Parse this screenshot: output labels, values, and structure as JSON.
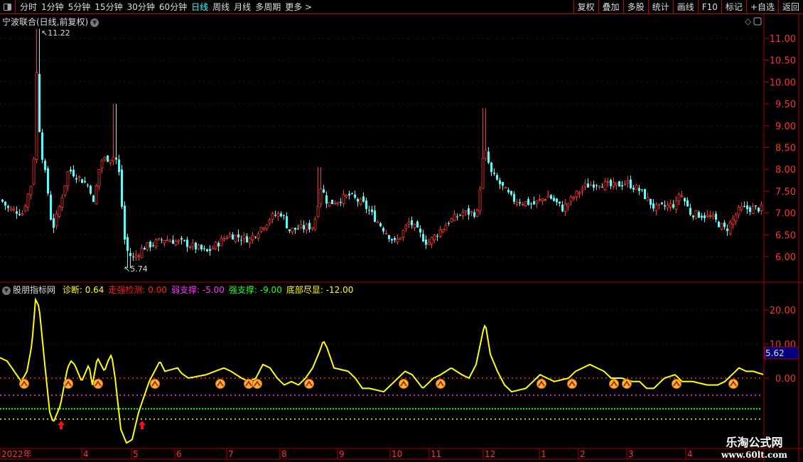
{
  "toolbar": {
    "periods": [
      "分时",
      "1分钟",
      "5分钟",
      "15分钟",
      "30分钟",
      "60分钟",
      "日线",
      "周线",
      "月线",
      "多周期",
      "更多 >"
    ],
    "active": "日线",
    "buttons": [
      "复权",
      "叠加",
      "多股",
      "统计",
      "画线",
      "F10",
      "标记",
      "+自选",
      "返回"
    ]
  },
  "main": {
    "title": "宁波联合(日线,前复权)",
    "high_label": "11.22",
    "low_label": "5.74",
    "y_ticks": [
      "11.00",
      "10.50",
      "10.00",
      "9.50",
      "9.00",
      "8.50",
      "8.00",
      "7.50",
      "7.00",
      "6.50",
      "6.00"
    ]
  },
  "indicator": {
    "name": "股朋指标网",
    "items": [
      {
        "label": "诊断: 0.64",
        "color": "#ffff00"
      },
      {
        "label": "走强检测: 0.00",
        "color": "#ff2020"
      },
      {
        "label": "弱支撑: -5.00",
        "color": "#ff30ff"
      },
      {
        "label": "强支撑: -9.00",
        "color": "#20ff20"
      },
      {
        "label": "底部尽显: -12.00",
        "color": "#ffff00"
      }
    ],
    "y_ticks": [
      "20.00",
      "10.00",
      "0.00"
    ],
    "current_value": "5.62"
  },
  "x_axis": {
    "labels": [
      "2022年",
      "4",
      "5",
      "6",
      "7",
      "8",
      "9",
      "10",
      "11",
      "12",
      "1",
      "2",
      "3",
      "4"
    ]
  },
  "watermark": {
    "line1": "乐淘公式网",
    "line2": "www.60lt.com"
  },
  "colors": {
    "up": "#ff3232",
    "down": "#54ffff",
    "line": "#ffff00",
    "grid": "#b00000"
  },
  "chart_data": {
    "type": "line",
    "xlim": [
      0,
      1075
    ],
    "price": {
      "ylim": [
        5.5,
        11.5
      ],
      "keypoints": [
        [
          0,
          7.3
        ],
        [
          10,
          7.1
        ],
        [
          30,
          7.0
        ],
        [
          45,
          7.8
        ],
        [
          50,
          10.2
        ],
        [
          55,
          8.6
        ],
        [
          65,
          7.6
        ],
        [
          72,
          6.6
        ],
        [
          80,
          7.0
        ],
        [
          95,
          8.0
        ],
        [
          110,
          7.8
        ],
        [
          125,
          7.6
        ],
        [
          130,
          7.2
        ],
        [
          140,
          8.2
        ],
        [
          160,
          8.3
        ],
        [
          165,
          8.1
        ],
        [
          175,
          6.2
        ],
        [
          185,
          5.95
        ],
        [
          200,
          6.2
        ],
        [
          230,
          6.4
        ],
        [
          260,
          6.3
        ],
        [
          290,
          6.1
        ],
        [
          320,
          6.5
        ],
        [
          350,
          6.4
        ],
        [
          380,
          6.9
        ],
        [
          395,
          7.0
        ],
        [
          405,
          6.6
        ],
        [
          440,
          6.7
        ],
        [
          450,
          7.6
        ],
        [
          460,
          7.2
        ],
        [
          490,
          7.4
        ],
        [
          510,
          7.2
        ],
        [
          530,
          6.8
        ],
        [
          555,
          6.3
        ],
        [
          575,
          6.8
        ],
        [
          600,
          6.3
        ],
        [
          630,
          6.8
        ],
        [
          650,
          7.0
        ],
        [
          670,
          7.0
        ],
        [
          680,
          8.5
        ],
        [
          690,
          7.9
        ],
        [
          700,
          7.7
        ],
        [
          720,
          7.3
        ],
        [
          750,
          7.2
        ],
        [
          770,
          7.4
        ],
        [
          790,
          7.1
        ],
        [
          820,
          7.6
        ],
        [
          840,
          7.7
        ],
        [
          860,
          7.6
        ],
        [
          880,
          7.7
        ],
        [
          900,
          7.5
        ],
        [
          920,
          7.1
        ],
        [
          950,
          7.2
        ],
        [
          955,
          7.5
        ],
        [
          970,
          7.0
        ],
        [
          1000,
          6.9
        ],
        [
          1020,
          6.6
        ],
        [
          1040,
          7.1
        ],
        [
          1075,
          7.1
        ]
      ]
    },
    "indicator": {
      "ylim": [
        -20,
        26
      ],
      "levels": [
        0,
        -5,
        -9,
        -12
      ],
      "keypoints": [
        [
          0,
          6
        ],
        [
          10,
          5
        ],
        [
          20,
          2
        ],
        [
          30,
          -1
        ],
        [
          38,
          2
        ],
        [
          45,
          10
        ],
        [
          50,
          23
        ],
        [
          55,
          21
        ],
        [
          65,
          0
        ],
        [
          70,
          -10
        ],
        [
          75,
          -13
        ],
        [
          85,
          -8
        ],
        [
          95,
          3
        ],
        [
          100,
          5
        ],
        [
          105,
          4
        ],
        [
          115,
          -1
        ],
        [
          125,
          4
        ],
        [
          130,
          -2
        ],
        [
          137,
          6
        ],
        [
          142,
          4
        ],
        [
          147,
          2
        ],
        [
          152,
          5
        ],
        [
          157,
          7
        ],
        [
          162,
          0
        ],
        [
          170,
          -15
        ],
        [
          178,
          -19
        ],
        [
          186,
          -18
        ],
        [
          195,
          -10
        ],
        [
          205,
          -4
        ],
        [
          210,
          -1
        ],
        [
          220,
          3
        ],
        [
          225,
          5
        ],
        [
          232,
          2
        ],
        [
          250,
          3
        ],
        [
          255,
          1.5
        ],
        [
          265,
          0
        ],
        [
          290,
          1
        ],
        [
          315,
          3
        ],
        [
          325,
          2
        ],
        [
          340,
          0
        ],
        [
          350,
          -1
        ],
        [
          360,
          0
        ],
        [
          370,
          4
        ],
        [
          380,
          3
        ],
        [
          390,
          0
        ],
        [
          400,
          -2
        ],
        [
          410,
          -1
        ],
        [
          420,
          -2
        ],
        [
          430,
          0
        ],
        [
          440,
          3
        ],
        [
          450,
          8
        ],
        [
          455,
          11
        ],
        [
          460,
          9
        ],
        [
          470,
          3
        ],
        [
          490,
          2
        ],
        [
          500,
          0
        ],
        [
          510,
          -3
        ],
        [
          520,
          -3
        ],
        [
          540,
          -4
        ],
        [
          560,
          0
        ],
        [
          570,
          2
        ],
        [
          580,
          1
        ],
        [
          595,
          -3
        ],
        [
          610,
          0
        ],
        [
          620,
          1
        ],
        [
          635,
          3
        ],
        [
          650,
          1
        ],
        [
          660,
          0
        ],
        [
          670,
          4
        ],
        [
          680,
          14
        ],
        [
          683,
          16
        ],
        [
          690,
          7
        ],
        [
          700,
          2
        ],
        [
          710,
          -2
        ],
        [
          720,
          -4
        ],
        [
          740,
          -3
        ],
        [
          760,
          1
        ],
        [
          770,
          0
        ],
        [
          780,
          -1
        ],
        [
          800,
          0
        ],
        [
          810,
          2
        ],
        [
          830,
          4
        ],
        [
          850,
          2
        ],
        [
          860,
          0
        ],
        [
          875,
          0
        ],
        [
          890,
          -1
        ],
        [
          900,
          -1
        ],
        [
          910,
          -3
        ],
        [
          920,
          -3
        ],
        [
          935,
          0
        ],
        [
          950,
          1
        ],
        [
          960,
          -1
        ],
        [
          975,
          -1
        ],
        [
          995,
          -2
        ],
        [
          1010,
          -2
        ],
        [
          1020,
          -1
        ],
        [
          1030,
          1
        ],
        [
          1040,
          3
        ],
        [
          1050,
          2
        ],
        [
          1060,
          2
        ],
        [
          1075,
          1
        ]
      ],
      "signals": [
        34,
        96,
        138,
        218,
        310,
        350,
        362,
        435,
        568,
        620,
        762,
        805,
        864,
        882,
        952,
        1032
      ],
      "arrows": [
        86,
        200
      ]
    }
  }
}
